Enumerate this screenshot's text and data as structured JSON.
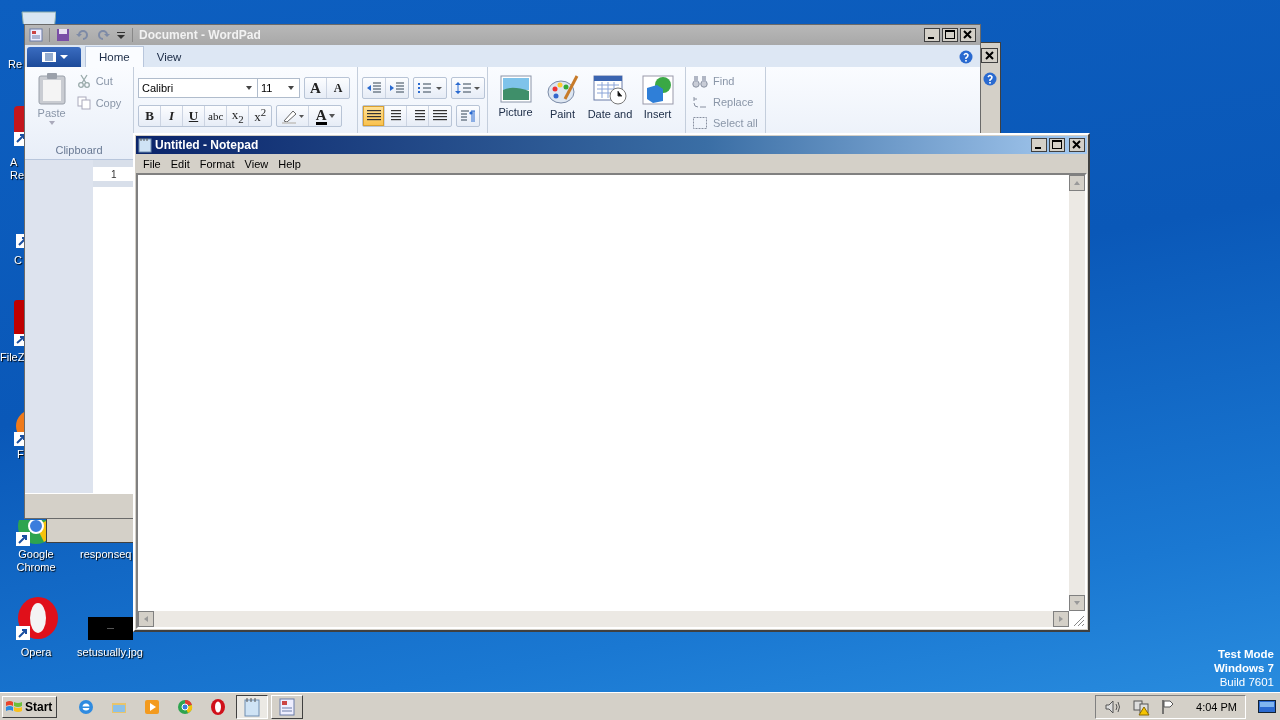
{
  "desktop": {
    "icons": [
      {
        "kind": "recycle",
        "lines": [
          "Re"
        ]
      },
      {
        "kind": "acrobat",
        "lines": [
          "A",
          "Re"
        ]
      },
      {
        "kind": "shortcut",
        "lines": [
          "C"
        ]
      },
      {
        "kind": "filezilla",
        "lines": [
          "FileZ"
        ]
      },
      {
        "kind": "firefox",
        "lines": [
          "F"
        ]
      },
      {
        "kind": "chrome",
        "lines": [
          "Google",
          "Chrome"
        ]
      },
      {
        "kind": "hidden",
        "lines": [
          "responseq"
        ]
      },
      {
        "kind": "opera",
        "lines": [
          "Opera"
        ]
      },
      {
        "kind": "image",
        "lines": [
          "setusually.jpg"
        ]
      }
    ],
    "system_text": [
      "Test Mode",
      "Windows 7",
      "Build 7601"
    ]
  },
  "wordpad": {
    "title": "Document - WordPad",
    "tabs": [
      {
        "label": "Home",
        "selected": true
      },
      {
        "label": "View",
        "selected": false
      }
    ],
    "clipboard": {
      "paste": "Paste",
      "cut": "Cut",
      "copy": "Copy",
      "group": "Clipboard"
    },
    "font": {
      "family": "Calibri",
      "size": "11",
      "grow": "A",
      "shrink": "A",
      "styles": [
        "B",
        "I",
        "U",
        "abc",
        "x$_{2}$",
        "x$^{2}$"
      ],
      "color_letter": "A"
    },
    "alignment": [
      {
        "selected": true
      },
      {
        "selected": false
      },
      {
        "selected": false
      },
      {
        "selected": false
      }
    ],
    "insert": [
      "Picture",
      "Paint",
      "Date and",
      "Insert"
    ],
    "editing": [
      {
        "label": "Find",
        "disabled": true
      },
      {
        "label": "Replace",
        "disabled": true
      },
      {
        "label": "Select all",
        "disabled": true
      }
    ],
    "ruler": "1"
  },
  "notepad": {
    "title": "Untitled - Notepad",
    "menu": [
      "File",
      "Edit",
      "Format",
      "View",
      "Help"
    ]
  },
  "taskbar": {
    "start": "Start",
    "quick_launch": [
      {
        "kind": "ie"
      },
      {
        "kind": "explorer"
      },
      {
        "kind": "media"
      },
      {
        "kind": "chrome"
      },
      {
        "kind": "opera"
      }
    ],
    "tasks": [
      {
        "kind": "notepad",
        "selected": true
      },
      {
        "kind": "wordpad",
        "selected": false
      }
    ],
    "clock": "4:04 PM"
  }
}
